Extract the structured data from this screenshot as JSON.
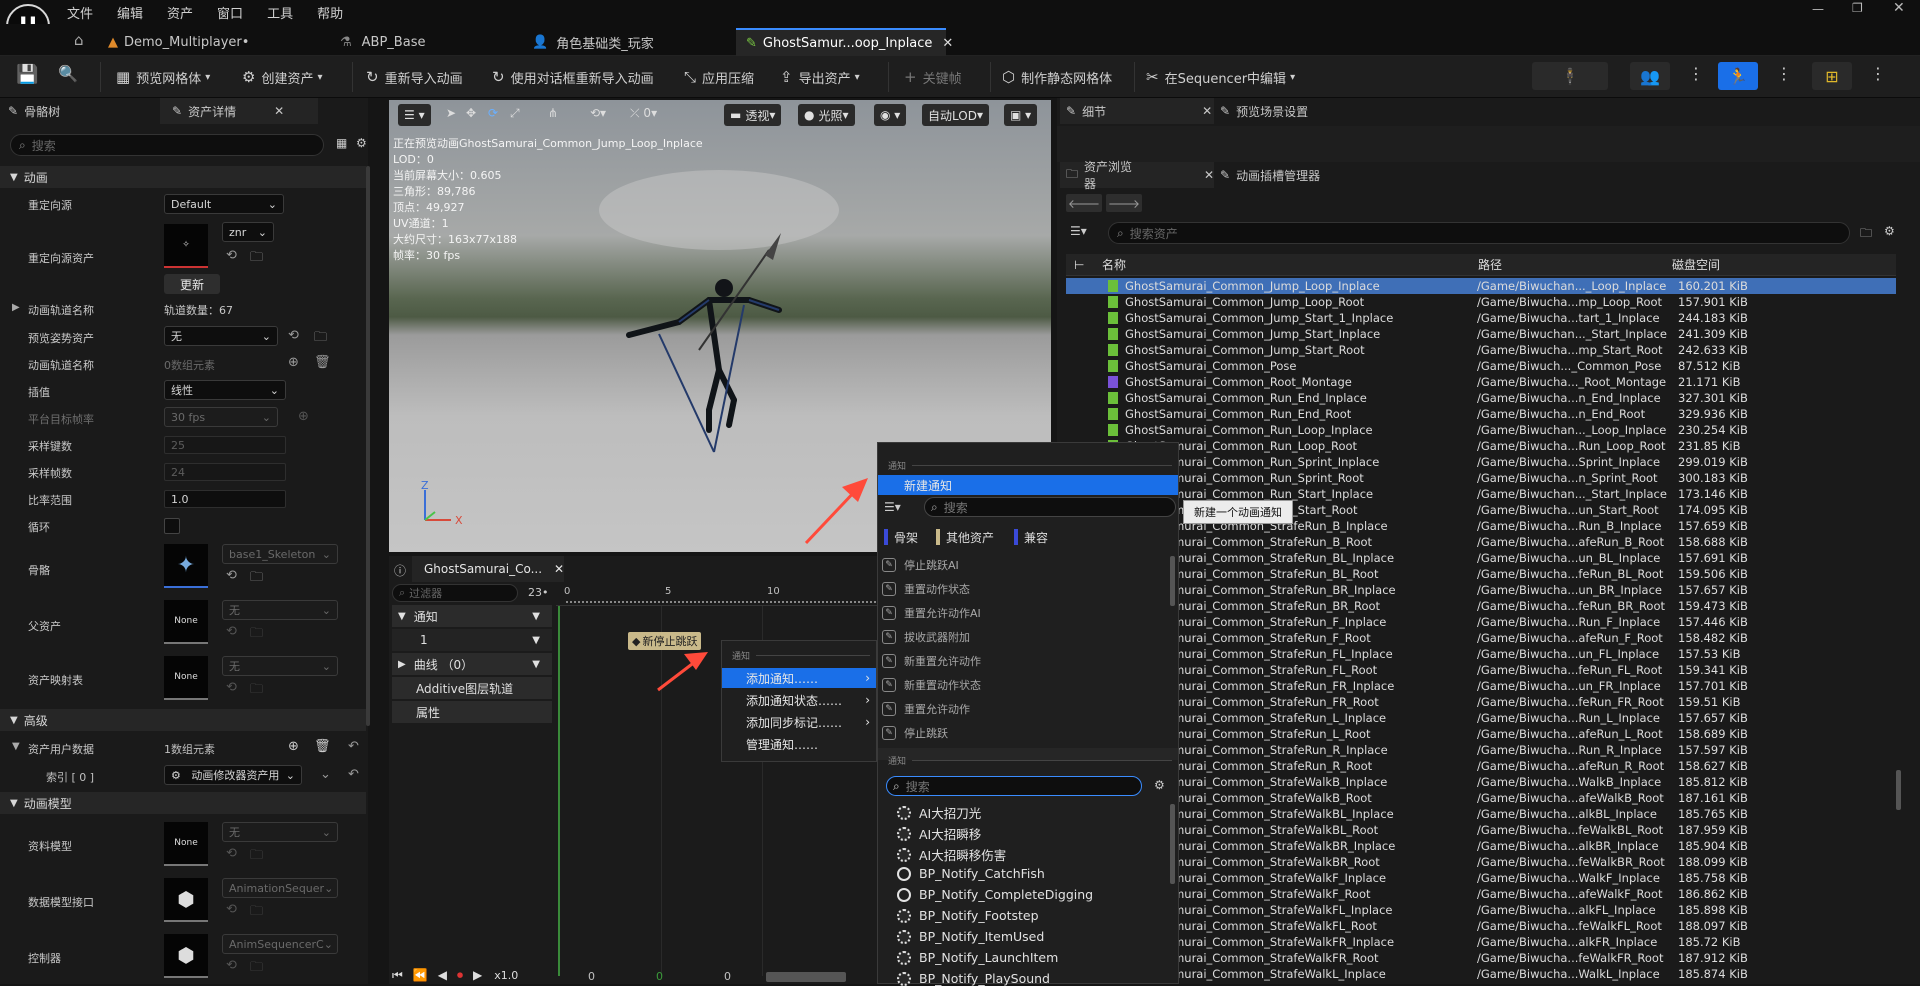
{
  "menu": [
    "文件",
    "编辑",
    "资产",
    "窗口",
    "工具",
    "帮助"
  ],
  "tabs": [
    {
      "label": "Demo_Multiplayer•"
    },
    {
      "label": "ABP_Base"
    },
    {
      "label": "角色基础类_玩家"
    },
    {
      "label": "GhostSamur...oop_Inplace"
    }
  ],
  "toolbar": {
    "preview_mesh": "预览网格体",
    "create_asset": "创建资产",
    "reimport": "重新导入动画",
    "reimport_dialog": "使用对话框重新导入动画",
    "apply_compress": "应用压缩",
    "export_asset": "导出资产",
    "keyframe": "关键帧",
    "make_static_mesh": "制作静态网格体",
    "edit_in_sequencer": "在Sequencer中编辑"
  },
  "left": {
    "tab_skeleton": "骨骼树",
    "tab_details": "资产详情",
    "search_placeholder": "搜索",
    "sections": {
      "anim": "动画",
      "advanced": "高级",
      "anim_model": "动画模型"
    },
    "props": {
      "retarget_source": "重定向源",
      "retarget_source_val": "Default",
      "retarget_asset": "重定向源资产",
      "znr": "znr",
      "update": "更新",
      "track_names": "动画轨道名称",
      "track_count": "轨道数量：67",
      "preview_pose": "预览姿势资产",
      "preview_pose_val": "无",
      "anim_track_names": "动画轨道名称",
      "anim_track_val": "0数组元素",
      "interp": "插值",
      "interp_val": "线性",
      "platform_fps": "平台目标帧率",
      "platform_fps_val": "30 fps",
      "sample_keys": "采样键数",
      "sample_keys_val": "25",
      "sample_frames": "采样帧数",
      "sample_frames_val": "24",
      "rate_scale": "比率范围",
      "rate_scale_val": "1.0",
      "loop": "循环",
      "skeleton": "骨骼",
      "skeleton_val": "base1_Skeleton",
      "parent_asset": "父资产",
      "none": "无",
      "none_thumb": "None",
      "asset_mapping": "资产映射表",
      "asset_user_data": "资产用户数据",
      "asset_user_data_val": "1数组元素",
      "index0": "索引 [ 0 ]",
      "index0_val": "动画修改器资产用",
      "data_model": "资料模型",
      "data_model_iface": "数据模型接口",
      "data_model_iface_val": "AnimationSequer",
      "controller": "控制器",
      "controller_val": "AnimSequencerC"
    }
  },
  "viewport": {
    "info": [
      "正在预览动画GhostSamurai_Common_Jump_Loop_Inplace",
      "LOD：0",
      "当前屏幕大小：0.605",
      "三角形：89,786",
      "顶点：49,927",
      "UV通道：1",
      "大约尺寸：163x77x188",
      "帧率：30 fps"
    ],
    "perspective": "透视",
    "lit": "光照",
    "auto_lod": "自动LOD",
    "zero": "0"
  },
  "timeline": {
    "tab": "GhostSamurai_Co...",
    "filter_placeholder": "过滤器",
    "count": "23•",
    "rows": [
      "通知",
      "1",
      "曲线 （0）",
      "Additive图层轨道",
      "属性"
    ],
    "ticks": [
      "0",
      "5",
      "10"
    ],
    "notify_tag": "新停止跳跃",
    "play_rate": "x1.0",
    "bottom_nums": [
      "0",
      "0",
      "0"
    ]
  },
  "context_menu": {
    "header": "通知",
    "items": [
      "添加通知……",
      "添加通知状态……",
      "添加同步标记……",
      "管理通知……"
    ]
  },
  "submenu": {
    "header": "通知",
    "new_notify": "新建通知",
    "tooltip": "新建一个动画通知",
    "search_placeholder": "搜索",
    "filters": [
      "骨架",
      "其他资产",
      "兼容"
    ],
    "skeleton_notifies": [
      "停止跳跃AI",
      "重置动作状态",
      "重置允许动作AI",
      "拔收武器附加",
      "新重置允许动作",
      "新重置动作状态",
      "重置允许动作",
      "停止跳跃"
    ],
    "header2": "通知",
    "search2_placeholder": "搜索",
    "bp_notifies": [
      "AI大招刀光",
      "AI大招瞬移",
      "AI大招瞬移伤害",
      "BP_Notify_CatchFish",
      "BP_Notify_CompleteDigging",
      "BP_Notify_Footstep",
      "BP_Notify_ItemUsed",
      "BP_Notify_LaunchItem",
      "BP_Notify_PlaySound"
    ]
  },
  "right": {
    "tab_details": "细节",
    "tab_preview_settings": "预览场景设置",
    "tab_content_browser": "资产浏览器",
    "tab_slot_manager": "动画插槽管理器",
    "search_placeholder": "搜索资产",
    "col_name": "名称",
    "col_path": "路径",
    "col_size": "磁盘空间",
    "assets": [
      [
        "GhostSamurai_Common_Jump_Loop_Inplace",
        "/Game/Biwuchan..._Loop_Inplace",
        "160.201 KiB"
      ],
      [
        "GhostSamurai_Common_Jump_Loop_Root",
        "/Game/Biwucha...mp_Loop_Root",
        "157.901 KiB"
      ],
      [
        "GhostSamurai_Common_Jump_Start_1_Inplace",
        "/Game/Biwucha...tart_1_Inplace",
        "244.183 KiB"
      ],
      [
        "GhostSamurai_Common_Jump_Start_Inplace",
        "/Game/Biwuchan..._Start_Inplace",
        "241.309 KiB"
      ],
      [
        "GhostSamurai_Common_Jump_Start_Root",
        "/Game/Biwucha...mp_Start_Root",
        "242.633 KiB"
      ],
      [
        "GhostSamurai_Common_Pose",
        "/Game/Biwuch..._Common_Pose",
        "87.512 KiB"
      ],
      [
        "GhostSamurai_Common_Root_Montage",
        "/Game/Biwucha..._Root_Montage",
        "21.171 KiB"
      ],
      [
        "GhostSamurai_Common_Run_End_Inplace",
        "/Game/Biwucha...n_End_Inplace",
        "327.301 KiB"
      ],
      [
        "GhostSamurai_Common_Run_End_Root",
        "/Game/Biwucha...n_End_Root",
        "329.936 KiB"
      ],
      [
        "GhostSamurai_Common_Run_Loop_Inplace",
        "/Game/Biwuchan..._Loop_Inplace",
        "230.254 KiB"
      ],
      [
        "GhostSamurai_Common_Run_Loop_Root",
        "/Game/Biwucha...Run_Loop_Root",
        "231.85 KiB"
      ],
      [
        "GhostSamurai_Common_Run_Sprint_Inplace",
        "/Game/Biwucha...Sprint_Inplace",
        "299.019 KiB"
      ],
      [
        "GhostSamurai_Common_Run_Sprint_Root",
        "/Game/Biwucha...n_Sprint_Root",
        "300.183 KiB"
      ],
      [
        "GhostSamurai_Common_Run_Start_Inplace",
        "/Game/Biwuchan..._Start_Inplace",
        "173.146 KiB"
      ],
      [
        "GhostSamurai_Common_Run_Start_Root",
        "/Game/Biwucha...un_Start_Root",
        "174.095 KiB"
      ],
      [
        "GhostSamurai_Common_StrafeRun_B_Inplace",
        "/Game/Biwucha...Run_B_Inplace",
        "157.659 KiB"
      ],
      [
        "GhostSamurai_Common_StrafeRun_B_Root",
        "/Game/Biwucha...afeRun_B_Root",
        "158.688 KiB"
      ],
      [
        "GhostSamurai_Common_StrafeRun_BL_Inplace",
        "/Game/Biwucha...un_BL_Inplace",
        "157.691 KiB"
      ],
      [
        "GhostSamurai_Common_StrafeRun_BL_Root",
        "/Game/Biwucha...feRun_BL_Root",
        "159.506 KiB"
      ],
      [
        "GhostSamurai_Common_StrafeRun_BR_Inplace",
        "/Game/Biwucha...un_BR_Inplace",
        "157.657 KiB"
      ],
      [
        "GhostSamurai_Common_StrafeRun_BR_Root",
        "/Game/Biwucha...feRun_BR_Root",
        "159.473 KiB"
      ],
      [
        "GhostSamurai_Common_StrafeRun_F_Inplace",
        "/Game/Biwucha...Run_F_Inplace",
        "157.446 KiB"
      ],
      [
        "GhostSamurai_Common_StrafeRun_F_Root",
        "/Game/Biwucha...afeRun_F_Root",
        "158.482 KiB"
      ],
      [
        "GhostSamurai_Common_StrafeRun_FL_Inplace",
        "/Game/Biwucha...un_FL_Inplace",
        "157.53 KiB"
      ],
      [
        "GhostSamurai_Common_StrafeRun_FL_Root",
        "/Game/Biwucha...feRun_FL_Root",
        "159.341 KiB"
      ],
      [
        "GhostSamurai_Common_StrafeRun_FR_Inplace",
        "/Game/Biwucha...un_FR_Inplace",
        "157.701 KiB"
      ],
      [
        "GhostSamurai_Common_StrafeRun_FR_Root",
        "/Game/Biwucha...feRun_FR_Root",
        "159.51 KiB"
      ],
      [
        "GhostSamurai_Common_StrafeRun_L_Inplace",
        "/Game/Biwucha...Run_L_Inplace",
        "157.657 KiB"
      ],
      [
        "GhostSamurai_Common_StrafeRun_L_Root",
        "/Game/Biwucha...afeRun_L_Root",
        "158.689 KiB"
      ],
      [
        "GhostSamurai_Common_StrafeRun_R_Inplace",
        "/Game/Biwucha...Run_R_Inplace",
        "157.597 KiB"
      ],
      [
        "GhostSamurai_Common_StrafeRun_R_Root",
        "/Game/Biwucha...afeRun_R_Root",
        "158.627 KiB"
      ],
      [
        "GhostSamurai_Common_StrafeWalkB_Inplace",
        "/Game/Biwucha...WalkB_Inplace",
        "185.812 KiB"
      ],
      [
        "GhostSamurai_Common_StrafeWalkB_Root",
        "/Game/Biwucha...afeWalkB_Root",
        "187.161 KiB"
      ],
      [
        "GhostSamurai_Common_StrafeWalkBL_Inplace",
        "/Game/Biwucha...alkBL_Inplace",
        "185.765 KiB"
      ],
      [
        "GhostSamurai_Common_StrafeWalkBL_Root",
        "/Game/Biwucha...feWalkBL_Root",
        "187.959 KiB"
      ],
      [
        "GhostSamurai_Common_StrafeWalkBR_Inplace",
        "/Game/Biwucha...alkBR_Inplace",
        "185.904 KiB"
      ],
      [
        "GhostSamurai_Common_StrafeWalkBR_Root",
        "/Game/Biwucha...feWalkBR_Root",
        "188.099 KiB"
      ],
      [
        "GhostSamurai_Common_StrafeWalkF_Inplace",
        "/Game/Biwucha...WalkF_Inplace",
        "185.758 KiB"
      ],
      [
        "GhostSamurai_Common_StrafeWalkF_Root",
        "/Game/Biwucha...afeWalkF_Root",
        "186.862 KiB"
      ],
      [
        "GhostSamurai_Common_StrafeWalkFL_Inplace",
        "/Game/Biwucha...alkFL_Inplace",
        "185.898 KiB"
      ],
      [
        "GhostSamurai_Common_StrafeWalkFL_Root",
        "/Game/Biwucha...feWalkFL_Root",
        "188.097 KiB"
      ],
      [
        "GhostSamurai_Common_StrafeWalkFR_Inplace",
        "/Game/Biwucha...alkFR_Inplace",
        "185.72 KiB"
      ],
      [
        "GhostSamurai_Common_StrafeWalkFR_Root",
        "/Game/Biwucha...feWalkFR_Root",
        "187.912 KiB"
      ],
      [
        "GhostSamurai_Common_StrafeWalkL_Inplace",
        "/Game/Biwucha...WalkL_Inplace",
        "185.874 KiB"
      ]
    ]
  }
}
